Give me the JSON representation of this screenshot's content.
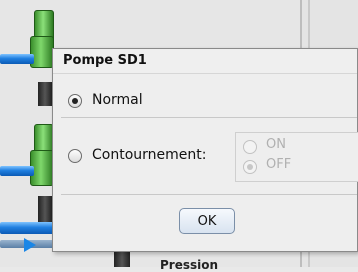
{
  "dialog": {
    "title": "Pompe SD1",
    "options": {
      "normal_label": "Normal",
      "normal_selected": true,
      "bypass_label": "Contournement:",
      "bypass_selected": false
    },
    "bypass_sub_options": {
      "on_label": "ON",
      "off_label": "OFF",
      "selected": "OFF",
      "enabled": false
    },
    "ok_label": "OK"
  },
  "background": {
    "partial_label": "Pression",
    "pipe_color": "#1f7fe0",
    "pump_color": "#4caf3a"
  }
}
